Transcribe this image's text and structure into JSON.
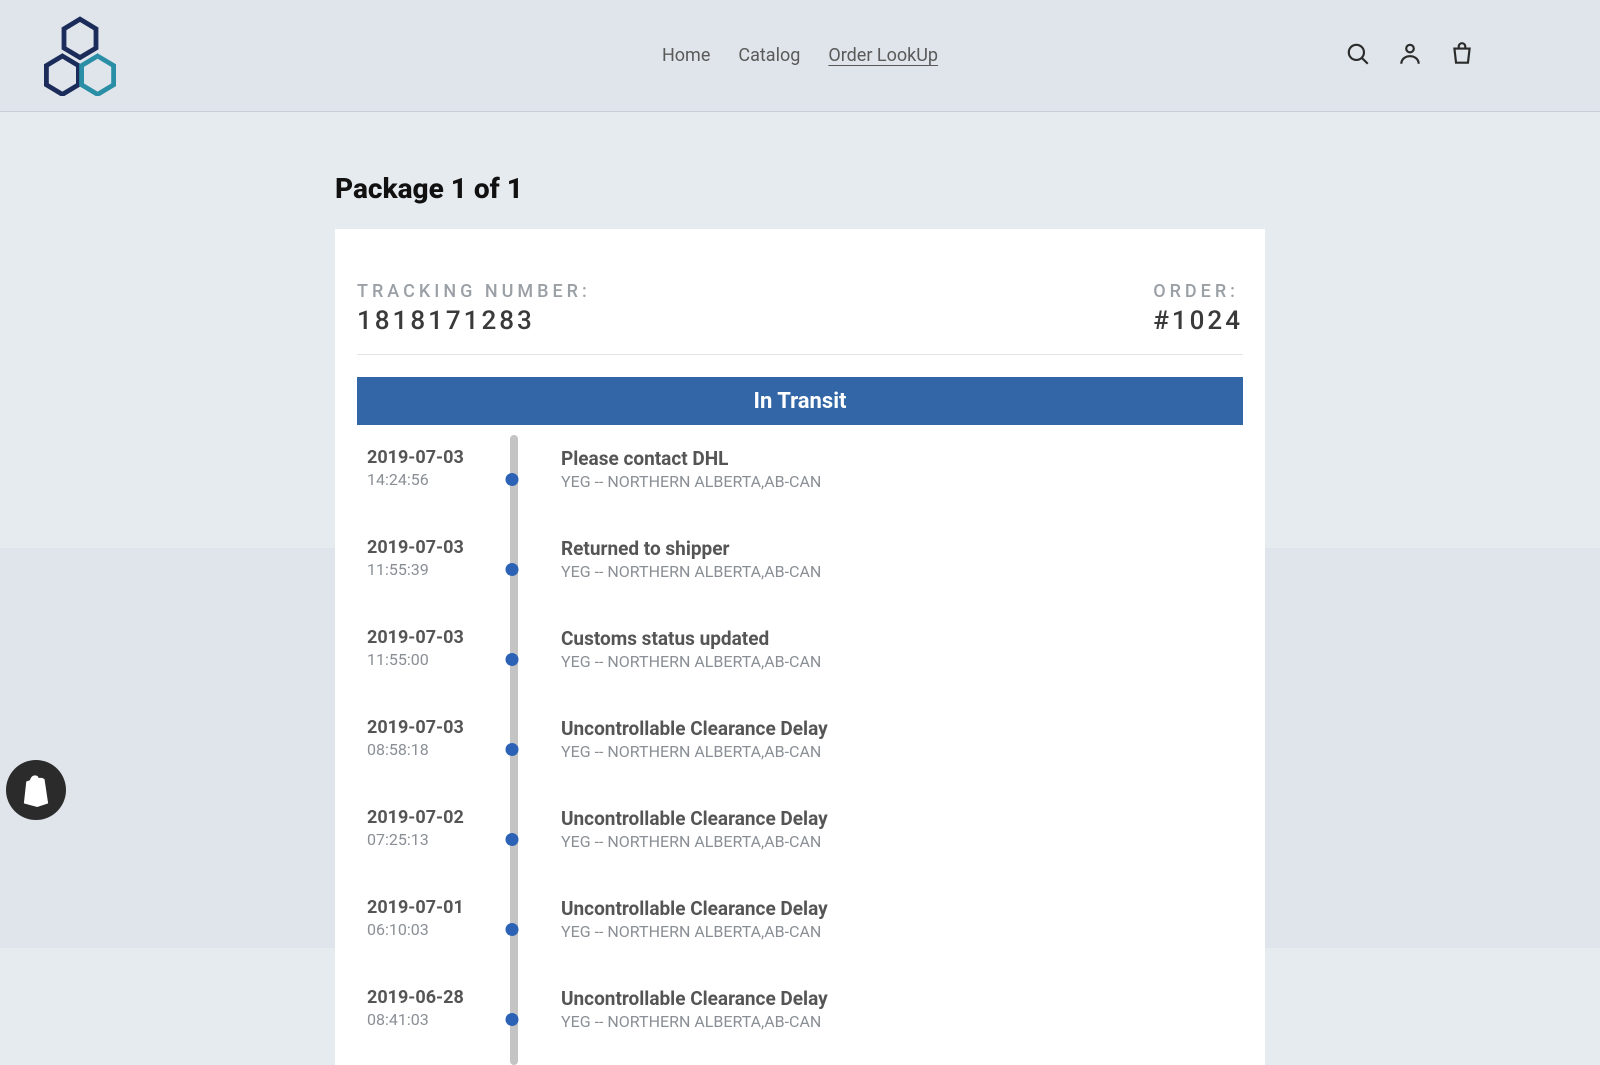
{
  "nav": {
    "home": "Home",
    "catalog": "Catalog",
    "order_lookup": "Order LookUp"
  },
  "page": {
    "package_title": "Package 1 of 1"
  },
  "tracking": {
    "label": "TRACKING NUMBER:",
    "value": "1818171283"
  },
  "order": {
    "label": "ORDER:",
    "value": "#1024"
  },
  "status": "In Transit",
  "events": [
    {
      "date": "2019-07-03",
      "time": "14:24:56",
      "title": "Please contact DHL",
      "loc": "YEG -- NORTHERN ALBERTA,AB-CAN"
    },
    {
      "date": "2019-07-03",
      "time": "11:55:39",
      "title": "Returned to shipper",
      "loc": "YEG -- NORTHERN ALBERTA,AB-CAN"
    },
    {
      "date": "2019-07-03",
      "time": "11:55:00",
      "title": "Customs status updated",
      "loc": "YEG -- NORTHERN ALBERTA,AB-CAN"
    },
    {
      "date": "2019-07-03",
      "time": "08:58:18",
      "title": "Uncontrollable Clearance Delay",
      "loc": "YEG -- NORTHERN ALBERTA,AB-CAN"
    },
    {
      "date": "2019-07-02",
      "time": "07:25:13",
      "title": "Uncontrollable Clearance Delay",
      "loc": "YEG -- NORTHERN ALBERTA,AB-CAN"
    },
    {
      "date": "2019-07-01",
      "time": "06:10:03",
      "title": "Uncontrollable Clearance Delay",
      "loc": "YEG -- NORTHERN ALBERTA,AB-CAN"
    },
    {
      "date": "2019-06-28",
      "time": "08:41:03",
      "title": "Uncontrollable Clearance Delay",
      "loc": "YEG -- NORTHERN ALBERTA,AB-CAN"
    }
  ]
}
